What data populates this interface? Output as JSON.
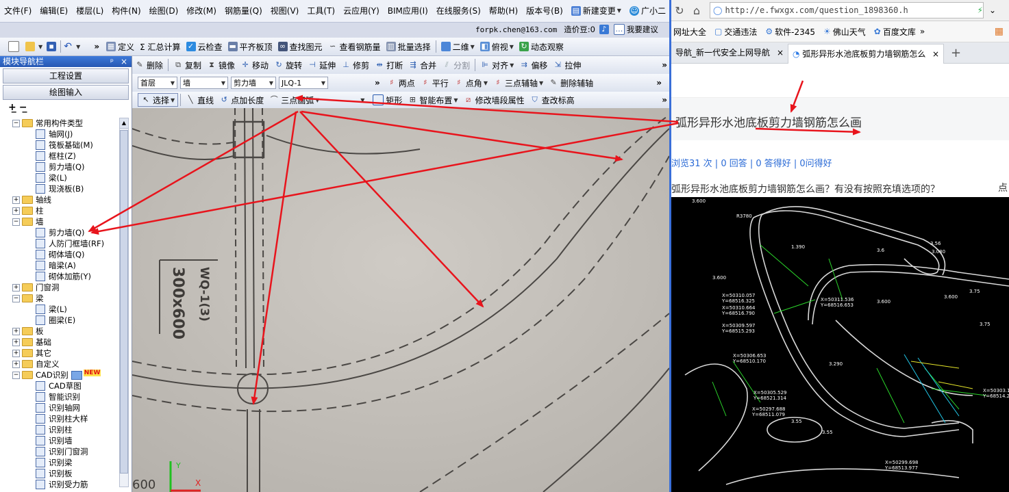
{
  "menus": [
    "文件(F)",
    "编辑(E)",
    "楼层(L)",
    "构件(N)",
    "绘图(D)",
    "修改(M)",
    "钢筋量(Q)",
    "视图(V)",
    "工具(T)",
    "云应用(Y)",
    "BIM应用(I)",
    "在线服务(S)",
    "帮助(H)",
    "版本号(B)",
    "新建变更",
    "广小二"
  ],
  "account": {
    "email": "forpk.chen@163.com",
    "credit": "造价豆:0",
    "suggest": "我要建议"
  },
  "toolbar1": {
    "more": "»",
    "define": "定义",
    "sum": "Σ 汇总计算",
    "cloud_check": "云检查",
    "flat_top": "平齐板顶",
    "find": "查找图元",
    "view_rebar": "查看钢筋量",
    "batch": "批量选择",
    "view2d": "二维",
    "view_top": "俯视",
    "dyn": "动态观察"
  },
  "toolbar2": {
    "delete": "删除",
    "copy": "复制",
    "mirror": "镜像",
    "move": "移动",
    "rotate": "旋转",
    "extend": "延伸",
    "trim": "修剪",
    "break": "打断",
    "merge": "合并",
    "split": "分割",
    "align": "对齐",
    "offset": "偏移",
    "stretch": "拉伸"
  },
  "toolbar3": {
    "floor": "首层",
    "type": "墙",
    "sub": "剪力墙",
    "name": "JLQ-1",
    "two_point": "两点",
    "parallel": "平行",
    "angle": "点角",
    "three_aux": "三点辅轴",
    "del_aux": "删除辅轴"
  },
  "toolbar4": {
    "select": "选择",
    "line": "直线",
    "point_len": "点加长度",
    "arc": "三点画弧",
    "rect": "矩形",
    "smart": "智能布置",
    "modify_seg": "修改墙段属性",
    "check_elev": "查改标高"
  },
  "nav": {
    "title": "模块导航栏",
    "pin": "ᵖ",
    "close": "×",
    "project": "工程设置",
    "draw": "绘图输入"
  },
  "tree": [
    {
      "lvl": 0,
      "pm": "−",
      "label": "常用构件类型",
      "folder": true
    },
    {
      "lvl": 1,
      "label": "轴网(J)"
    },
    {
      "lvl": 1,
      "label": "筏板基础(M)"
    },
    {
      "lvl": 1,
      "label": "框柱(Z)"
    },
    {
      "lvl": 1,
      "label": "剪力墙(Q)"
    },
    {
      "lvl": 1,
      "label": "梁(L)"
    },
    {
      "lvl": 1,
      "label": "现浇板(B)"
    },
    {
      "lvl": 0,
      "pm": "+",
      "label": "轴线",
      "folder": true
    },
    {
      "lvl": 0,
      "pm": "+",
      "label": "柱",
      "folder": true
    },
    {
      "lvl": 0,
      "pm": "−",
      "label": "墙",
      "folder": true
    },
    {
      "lvl": 1,
      "label": "剪力墙(Q)"
    },
    {
      "lvl": 1,
      "label": "人防门框墙(RF)"
    },
    {
      "lvl": 1,
      "label": "砌体墙(Q)"
    },
    {
      "lvl": 1,
      "label": "暗梁(A)"
    },
    {
      "lvl": 1,
      "label": "砌体加筋(Y)"
    },
    {
      "lvl": 0,
      "pm": "+",
      "label": "门窗洞",
      "folder": true
    },
    {
      "lvl": 0,
      "pm": "−",
      "label": "梁",
      "folder": true
    },
    {
      "lvl": 1,
      "label": "梁(L)"
    },
    {
      "lvl": 1,
      "label": "圈梁(E)"
    },
    {
      "lvl": 0,
      "pm": "+",
      "label": "板",
      "folder": true
    },
    {
      "lvl": 0,
      "pm": "+",
      "label": "基础",
      "folder": true
    },
    {
      "lvl": 0,
      "pm": "+",
      "label": "其它",
      "folder": true
    },
    {
      "lvl": 0,
      "pm": "+",
      "label": "自定义",
      "folder": true
    },
    {
      "lvl": 0,
      "pm": "−",
      "label": "CAD识别",
      "folder": true,
      "badge": "NEW"
    },
    {
      "lvl": 1,
      "label": "CAD草图"
    },
    {
      "lvl": 1,
      "label": "智能识别"
    },
    {
      "lvl": 1,
      "label": "识别轴网"
    },
    {
      "lvl": 1,
      "label": "识别柱大样"
    },
    {
      "lvl": 1,
      "label": "识别柱"
    },
    {
      "lvl": 1,
      "label": "识别墙"
    },
    {
      "lvl": 1,
      "label": "识别门窗洞"
    },
    {
      "lvl": 1,
      "label": "识别梁"
    },
    {
      "lvl": 1,
      "label": "识别板"
    },
    {
      "lvl": 1,
      "label": "识别受力筋"
    }
  ],
  "canvas": {
    "wall_text_a": "WQ-1(3)",
    "wall_text_b": "300x600",
    "dim": "600",
    "axis_x": "X",
    "axis_y": "Y"
  },
  "browser": {
    "url": "http://e.fwxgx.com/question_1898360.h",
    "bookmarks": [
      "网址大全",
      "交通违法",
      "软件-2345",
      "佛山天气",
      "百度文库"
    ],
    "tabs": [
      "导航_新一代安全上网导航",
      "弧形异形水池底板剪力墙钢筋怎么"
    ],
    "question_title": "弧形异形水池底板剪力墙钢筋怎么画",
    "stats": "浏览31 次 | 0 回答 | 0 答得好 | 0问得好",
    "question_body": "弧形异形水池底板剪力墙钢筋怎么画？有没有按照充填选项的？",
    "corner": "点",
    "cad_labels": [
      "3.600",
      "R3780",
      "3.600",
      "1.390",
      "3.6",
      "3.56",
      "3.080",
      "3.600",
      "3.75",
      "X=50310.057",
      "Y=68516.325",
      "X=50310.664",
      "Y=68516.790",
      "X=50309.597",
      "Y=68515.293",
      "X=50306.653",
      "Y=68510.170",
      "X=50311.536",
      "Y=68516.653",
      "3.600",
      "3.75",
      "X=50305.529",
      "Y=68521.314",
      "X=50297.688",
      "Y=68511.079",
      "3.55",
      "3.55",
      "3.290",
      "X=50299.698",
      "Y=68513.977",
      "X=50303.1",
      "Y=68514.2"
    ]
  },
  "colors": {
    "arrow": "#e8141c",
    "cad_line": "#d9d9d9",
    "cad_green": "#2bd62b",
    "cad_cyan": "#21c7e8",
    "cad_yellow": "#e8e82a"
  }
}
